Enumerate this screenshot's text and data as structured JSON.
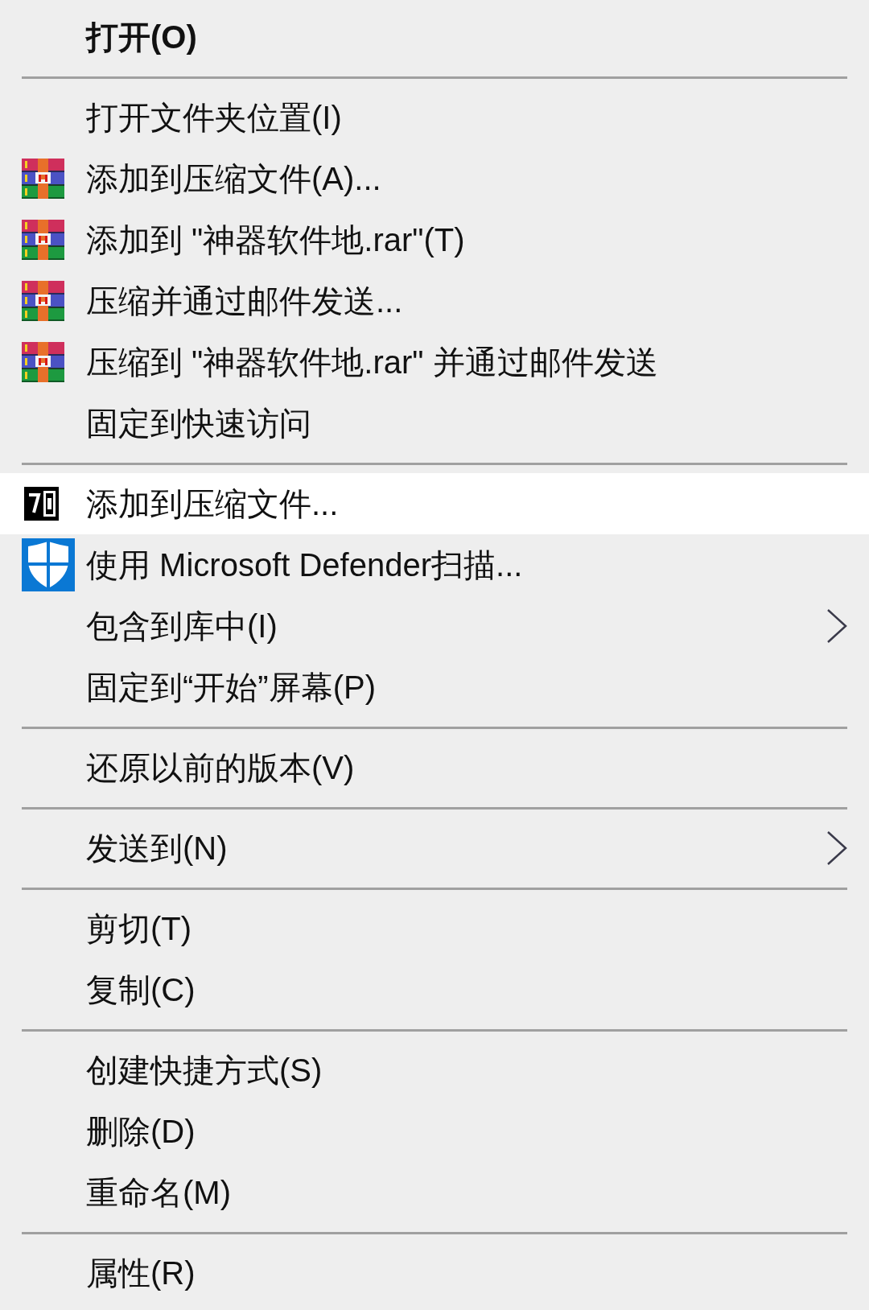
{
  "menu": {
    "sections": [
      {
        "items": [
          {
            "kind": "plain",
            "label": "打开(O)",
            "default": true,
            "selected": false,
            "submenu": false
          }
        ]
      },
      {
        "items": [
          {
            "kind": "plain",
            "label": "打开文件夹位置(I)",
            "default": false,
            "selected": false,
            "submenu": false
          },
          {
            "kind": "archive",
            "label": "添加到压缩文件(A)...",
            "default": false,
            "selected": false,
            "submenu": false
          },
          {
            "kind": "archive",
            "label": "添加到 \"神器软件地.rar\"(T)",
            "default": false,
            "selected": false,
            "submenu": false
          },
          {
            "kind": "archive",
            "label": "压缩并通过邮件发送...",
            "default": false,
            "selected": false,
            "submenu": false
          },
          {
            "kind": "archive",
            "label": "压缩到 \"神器软件地.rar\" 并通过邮件发送",
            "default": false,
            "selected": false,
            "submenu": false
          },
          {
            "kind": "plain",
            "label": "固定到快速访问",
            "default": false,
            "selected": false,
            "submenu": false
          }
        ]
      },
      {
        "items": [
          {
            "kind": "sevenzip",
            "label": "添加到压缩文件...",
            "default": false,
            "selected": true,
            "submenu": false
          },
          {
            "kind": "scan",
            "label": "使用 Microsoft Defender扫描...",
            "default": false,
            "selected": false,
            "submenu": false
          },
          {
            "kind": "plain",
            "label": "包含到库中(I)",
            "default": false,
            "selected": false,
            "submenu": true
          },
          {
            "kind": "plain",
            "label": "固定到“开始”屏幕(P)",
            "default": false,
            "selected": false,
            "submenu": false
          }
        ]
      },
      {
        "items": [
          {
            "kind": "plain",
            "label": "还原以前的版本(V)",
            "default": false,
            "selected": false,
            "submenu": false
          }
        ]
      },
      {
        "items": [
          {
            "kind": "plain",
            "label": "发送到(N)",
            "default": false,
            "selected": false,
            "submenu": true
          }
        ]
      },
      {
        "items": [
          {
            "kind": "plain",
            "label": "剪切(T)",
            "default": false,
            "selected": false,
            "submenu": false
          },
          {
            "kind": "plain",
            "label": "复制(C)",
            "default": false,
            "selected": false,
            "submenu": false
          }
        ]
      },
      {
        "items": [
          {
            "kind": "plain",
            "label": "创建快捷方式(S)",
            "default": false,
            "selected": false,
            "submenu": false
          },
          {
            "kind": "plain",
            "label": "删除(D)",
            "default": false,
            "selected": false,
            "submenu": false
          },
          {
            "kind": "plain",
            "label": "重命名(M)",
            "default": false,
            "selected": false,
            "submenu": false
          }
        ]
      },
      {
        "items": [
          {
            "kind": "plain",
            "label": "属性(R)",
            "default": false,
            "selected": false,
            "submenu": false
          }
        ]
      }
    ]
  }
}
